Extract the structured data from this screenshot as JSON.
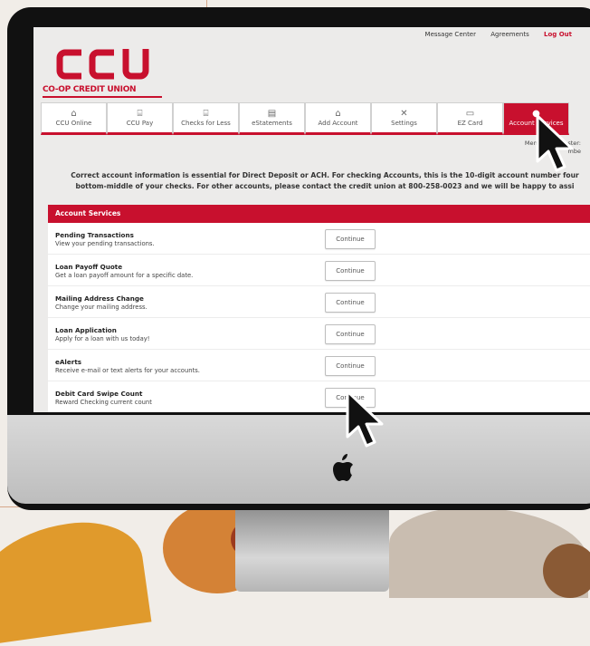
{
  "topnav": {
    "message_center": "Message Center",
    "agreements": "Agreements",
    "logout": "Log Out"
  },
  "logo": {
    "mark": "CCU",
    "name": "CO-OP CREDIT UNION"
  },
  "tabs": [
    {
      "label": "CCU Online",
      "icon": "home-icon"
    },
    {
      "label": "CCU Pay",
      "icon": "bank-icon"
    },
    {
      "label": "Checks for Less",
      "icon": "bank-icon"
    },
    {
      "label": "eStatements",
      "icon": "document-icon"
    },
    {
      "label": "Add Account",
      "icon": "bank-icon"
    },
    {
      "label": "Settings",
      "icon": "tools-icon"
    },
    {
      "label": "EZ Card",
      "icon": "card-icon"
    },
    {
      "label": "Account Services",
      "icon": "pin-icon"
    }
  ],
  "member": {
    "line1": "Member",
    "line1b": "ster:",
    "line2": "mbe"
  },
  "notice": {
    "line1": "Correct account information is essential for Direct Deposit or ACH. For checking Accounts, this is the 10-digit account number four",
    "line2": "bottom-middle of your checks. For other accounts, please contact the credit union at 800-258-0023 and we will be happy to assi"
  },
  "section_title": "Account Services",
  "services": [
    {
      "title": "Pending Transactions",
      "desc": "View your pending transactions.",
      "button": "Continue"
    },
    {
      "title": "Loan Payoff Quote",
      "desc": "Get a loan payoff amount for a specific date.",
      "button": "Continue"
    },
    {
      "title": "Mailing Address Change",
      "desc": "Change your mailing address.",
      "button": "Continue"
    },
    {
      "title": "Loan Application",
      "desc": "Apply for a loan with us today!",
      "button": "Continue"
    },
    {
      "title": "eAlerts",
      "desc": "Receive e-mail or text alerts for your accounts.",
      "button": "Continue"
    },
    {
      "title": "Debit Card Swipe Count",
      "desc": "Reward Checking current count",
      "button": "Continue"
    }
  ],
  "colors": {
    "brand_red": "#c8102e"
  }
}
